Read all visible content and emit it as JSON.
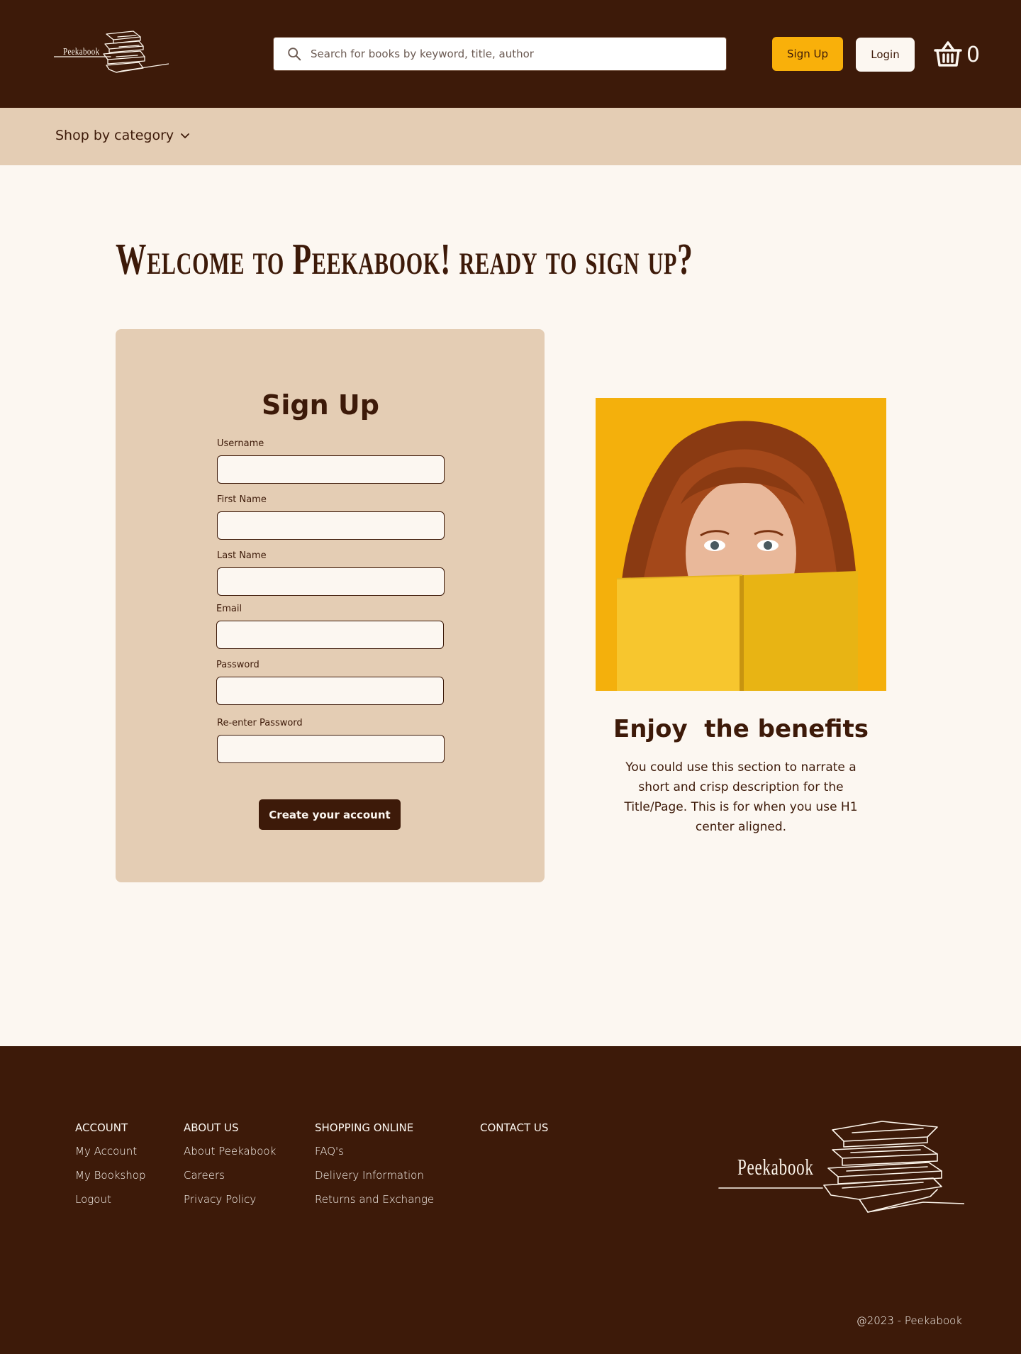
{
  "brand": {
    "logo_text": "Peekabook"
  },
  "header": {
    "search_placeholder": "Search for books by keyword, title, author",
    "signup_label": "Sign Up",
    "login_label": "Login",
    "cart_count": "0",
    "search_icon": "search-icon",
    "cart_icon": "basket-icon"
  },
  "category_bar": {
    "label": "Shop by category",
    "icon": "chevron-down-icon"
  },
  "main": {
    "welcome_heading": "Welcome to Peekabook! ready to sign up?",
    "form": {
      "title": "Sign Up",
      "fields": [
        {
          "label": "Username",
          "value": ""
        },
        {
          "label": "First Name",
          "value": ""
        },
        {
          "label": "Last Name",
          "value": ""
        },
        {
          "label": "Email",
          "value": ""
        },
        {
          "label": "Password",
          "value": ""
        },
        {
          "label": "Re-enter Password",
          "value": ""
        }
      ],
      "submit_label": "Create your account"
    },
    "benefits": {
      "title": "Enjoy  the benefits",
      "text": "You could use this section to narrate a short and crisp description for the Title/Page. This is for when you use H1 center aligned."
    }
  },
  "footer": {
    "columns": [
      {
        "heading": "ACCOUNT",
        "links": [
          "My Account",
          "My Bookshop",
          "Logout"
        ]
      },
      {
        "heading": "ABOUT US",
        "links": [
          "About Peekabook",
          "Careers",
          "Privacy Policy"
        ]
      },
      {
        "heading": "SHOPPING ONLINE",
        "links": [
          "FAQ's",
          "Delivery Information",
          "Returns and Exchange"
        ]
      },
      {
        "heading": "CONTACT US",
        "links": []
      }
    ],
    "logo_text": "Peekabook",
    "copyright": "@2023 - Peekabook"
  },
  "colors": {
    "dark_brown": "#3d1a09",
    "tan": "#e4cdb4",
    "cream": "#fcf7f1",
    "accent_yellow": "#f9b00a"
  }
}
